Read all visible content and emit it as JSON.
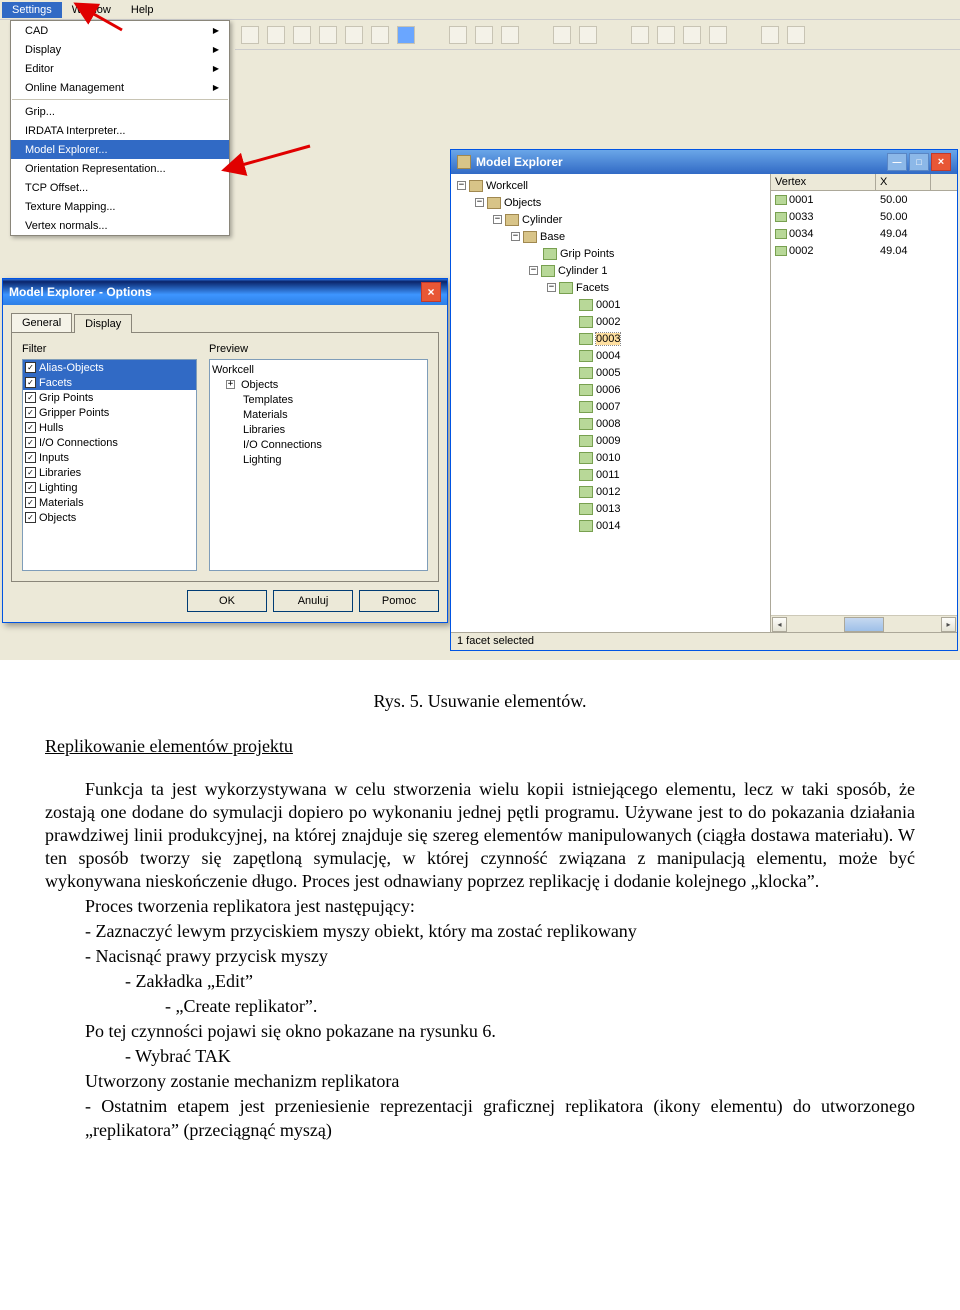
{
  "menu": {
    "items": [
      "Settings",
      "Window",
      "Help"
    ],
    "selected": 0
  },
  "dropdown": {
    "group1": [
      "CAD",
      "Display",
      "Editor",
      "Online Management"
    ],
    "group2": [
      "Grip...",
      "IRDATA Interpreter...",
      "Model Explorer...",
      "Orientation Representation...",
      "TCP Offset...",
      "Texture Mapping...",
      "Vertex normals..."
    ],
    "selected": "Model Explorer..."
  },
  "options_dlg": {
    "title": "Model Explorer - Options",
    "tabs": [
      "General",
      "Display"
    ],
    "active_tab": 1,
    "filter_label": "Filter",
    "preview_label": "Preview",
    "filters": [
      "Alias-Objects",
      "Facets",
      "Grip Points",
      "Gripper Points",
      "Hulls",
      "I/O Connections",
      "Inputs",
      "Libraries",
      "Lighting",
      "Materials",
      "Objects"
    ],
    "filters_selected": [
      0,
      1
    ],
    "preview_tree": {
      "root": "Workcell",
      "children": [
        "Objects",
        "Templates",
        "Materials",
        "Libraries",
        "I/O Connections",
        "Lighting"
      ]
    },
    "btn_ok": "OK",
    "btn_cancel": "Anuluj",
    "btn_help": "Pomoc"
  },
  "explorer": {
    "title": "Model Explorer",
    "tree": [
      {
        "d": 0,
        "exp": "-",
        "lbl": "Workcell"
      },
      {
        "d": 1,
        "exp": "-",
        "lbl": "Objects"
      },
      {
        "d": 2,
        "exp": "-",
        "lbl": "Cylinder"
      },
      {
        "d": 3,
        "exp": "-",
        "lbl": "Base"
      },
      {
        "d": 4,
        "exp": "",
        "lbl": "Grip Points"
      },
      {
        "d": 4,
        "exp": "-",
        "lbl": "Cylinder   1"
      },
      {
        "d": 5,
        "exp": "-",
        "lbl": "Facets"
      },
      {
        "d": 6,
        "exp": "",
        "lbl": "0001"
      },
      {
        "d": 6,
        "exp": "",
        "lbl": "0002"
      },
      {
        "d": 6,
        "exp": "",
        "lbl": "0003",
        "sel": true
      },
      {
        "d": 6,
        "exp": "",
        "lbl": "0004"
      },
      {
        "d": 6,
        "exp": "",
        "lbl": "0005"
      },
      {
        "d": 6,
        "exp": "",
        "lbl": "0006"
      },
      {
        "d": 6,
        "exp": "",
        "lbl": "0007"
      },
      {
        "d": 6,
        "exp": "",
        "lbl": "0008"
      },
      {
        "d": 6,
        "exp": "",
        "lbl": "0009"
      },
      {
        "d": 6,
        "exp": "",
        "lbl": "0010"
      },
      {
        "d": 6,
        "exp": "",
        "lbl": "0011"
      },
      {
        "d": 6,
        "exp": "",
        "lbl": "0012"
      },
      {
        "d": 6,
        "exp": "",
        "lbl": "0013"
      },
      {
        "d": 6,
        "exp": "",
        "lbl": "0014"
      }
    ],
    "columns": [
      "Vertex",
      "X"
    ],
    "rows": [
      {
        "v": "0001",
        "x": "50.00"
      },
      {
        "v": "0033",
        "x": "50.00"
      },
      {
        "v": "0034",
        "x": "49.04"
      },
      {
        "v": "0002",
        "x": "49.04"
      }
    ],
    "status": "1 facet selected"
  },
  "doc": {
    "caption": "Rys. 5. Usuwanie elementów.",
    "subtitle": "Replikowanie elementów projektu",
    "p1": "Funkcja ta jest wykorzystywana w celu stworzenia wielu kopii istniejącego elementu, lecz w taki sposób, że zostają one dodane do symulacji dopiero po wykonaniu jednej pętli programu. Używane jest to do pokazania działania prawdziwej linii produkcyjnej, na której znajduje się szereg elementów manipulowanych (ciągła dostawa materiału). W ten sposób tworzy się zapętloną symulację, w której czynność związana z manipulacją elementu, może być wykonywana nieskończenie długo. Proces jest odnawiany poprzez replikację i dodanie kolejnego „klocka”.",
    "p2": "Proces tworzenia replikatora jest następujący:",
    "b1": "- Zaznaczyć lewym przyciskiem myszy obiekt, który ma zostać replikowany",
    "b2": "- Nacisnąć prawy przycisk myszy",
    "b3": "- Zakładka „Edit”",
    "b4": "- „Create replikator”.",
    "p3": "Po tej czynności pojawi się okno pokazane na rysunku 6.",
    "b5": "- Wybrać TAK",
    "p4": "Utworzony zostanie mechanizm replikatora",
    "b6": "- Ostatnim etapem jest przeniesienie reprezentacji graficznej replikatora (ikony elementu) do utworzonego „replikatora” (przeciągnąć myszą)"
  }
}
